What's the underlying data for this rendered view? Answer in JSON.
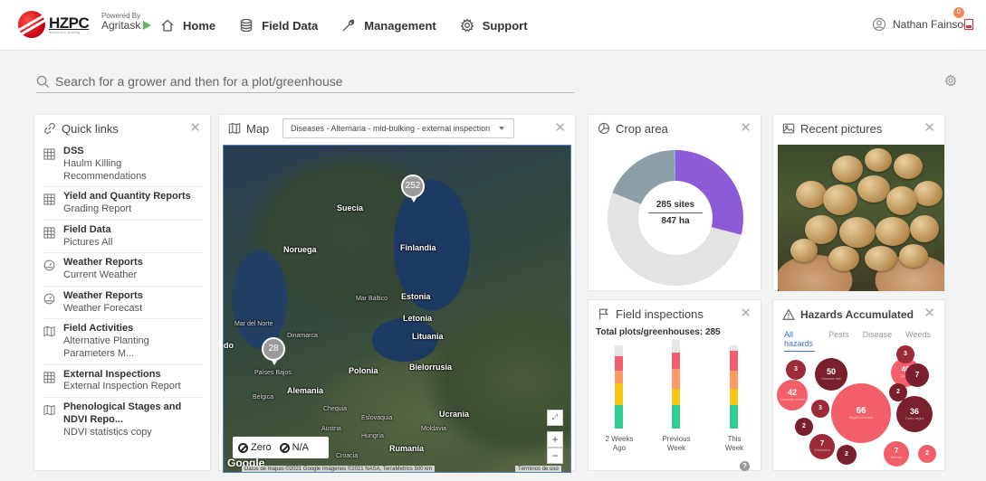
{
  "header": {
    "brand": "HZPC",
    "brand_tagline": "leaves you growing",
    "powered_by": "Powered By",
    "powered_brand": "Agritask",
    "nav": [
      {
        "label": "Home",
        "icon": "home-icon"
      },
      {
        "label": "Field Data",
        "icon": "database-icon"
      },
      {
        "label": "Management",
        "icon": "wrench-icon"
      },
      {
        "label": "Support",
        "icon": "gear-icon"
      }
    ],
    "user_name": "Nathan Fainsod",
    "notification_count": "0"
  },
  "search": {
    "placeholder": "Search for a grower and then for a plot/greenhouse"
  },
  "quick_links": {
    "title": "Quick links",
    "items": [
      {
        "title": "DSS",
        "sub": "Haulm Killing Recommendations",
        "icon": "grid-icon"
      },
      {
        "title": "Yield and Quantity Reports",
        "sub": "Grading Report",
        "icon": "grid-icon"
      },
      {
        "title": "Field Data",
        "sub": "Pictures All",
        "icon": "grid-icon"
      },
      {
        "title": "Weather Reports",
        "sub": "Current Weather",
        "icon": "speedometer-icon"
      },
      {
        "title": "Weather Reports",
        "sub": "Weather Forecast",
        "icon": "speedometer-icon"
      },
      {
        "title": "Field Activities",
        "sub": "Alternative Planting Parameters M...",
        "icon": "map-icon"
      },
      {
        "title": "External Inspections",
        "sub": "External Inspection Report",
        "icon": "grid-icon"
      },
      {
        "title": "Phenological Stages and NDVI Repo...",
        "sub": "NDVI statistics copy",
        "icon": "map-icon"
      }
    ]
  },
  "map": {
    "title": "Map",
    "selected_layer": "Diseases - Alternaria - mid-bulking - external inspection",
    "labels": [
      {
        "text": "Suecia",
        "bold": true
      },
      {
        "text": "Noruega",
        "bold": true
      },
      {
        "text": "Finlandia",
        "bold": true
      },
      {
        "text": "Mar Báltico",
        "bold": false
      },
      {
        "text": "Estonia",
        "bold": true
      },
      {
        "text": "Mar del Norte",
        "bold": false
      },
      {
        "text": "Letonia",
        "bold": true
      },
      {
        "text": "Dinamarca",
        "bold": false
      },
      {
        "text": "Lituania",
        "bold": true
      },
      {
        "text": "do",
        "bold": true
      },
      {
        "text": "Bielorrusia",
        "bold": true
      },
      {
        "text": "Países Bajos",
        "bold": false
      },
      {
        "text": "Polonia",
        "bold": true
      },
      {
        "text": "Alemania",
        "bold": true
      },
      {
        "text": "Bélgica",
        "bold": false
      },
      {
        "text": "Chequia",
        "bold": false
      },
      {
        "text": "Ucrania",
        "bold": true
      },
      {
        "text": "Eslovaquia",
        "bold": false
      },
      {
        "text": "Austria",
        "bold": false
      },
      {
        "text": "Moldavia",
        "bold": false
      },
      {
        "text": "Hungría",
        "bold": false
      },
      {
        "text": "Rumanía",
        "bold": true
      },
      {
        "text": "Croacia",
        "bold": false
      }
    ],
    "clusters": [
      {
        "count": "252"
      },
      {
        "count": "28"
      }
    ],
    "legend": [
      "Zero",
      "N/A"
    ],
    "zoom_in": "+",
    "zoom_out": "−",
    "google": "Google",
    "attribution": "Datos de mapas ©2021 Google Imágenes ©2021 NASA, TerraMetrics  500 km",
    "terms": "Términos de uso"
  },
  "crop_area": {
    "title": "Crop area",
    "sites": "285 sites",
    "hectares": "847 ha",
    "segments": [
      {
        "fraction": 0.29,
        "color": "#8e5bd6"
      },
      {
        "fraction": 0.52,
        "color": "#e3e3e3"
      },
      {
        "fraction": 0.185,
        "color": "#8d9ea7"
      },
      {
        "fraction": 0.005,
        "color": "#6fb8c8"
      }
    ]
  },
  "field_inspections": {
    "title": "Field inspections",
    "total": "Total plots/greenhouses: 285",
    "chart_data": {
      "type": "bar",
      "stacked": true,
      "categories": [
        "2 Weeks Ago",
        "Previous Week",
        "This Week"
      ],
      "series_colors": [
        "#2ecc8f",
        "#f5c518",
        "#ff9a66",
        "#f25f6a",
        "#e6e6e6"
      ]
    },
    "x_labels": [
      [
        "2 Weeks",
        "Ago"
      ],
      [
        "Previous",
        "Week"
      ],
      [
        "This",
        "Week"
      ]
    ],
    "help": "?"
  },
  "recent_pictures": {
    "title": "Recent pictures"
  },
  "hazards": {
    "title": "Hazards Accumulated",
    "tabs": [
      "All hazards",
      "Pests",
      "Disease",
      "Weeds"
    ],
    "bubbles": [
      {
        "value": "66",
        "sub": "Blight Infection"
      },
      {
        "value": "50",
        "sub": "Disease risk"
      },
      {
        "value": "42",
        "sub": "Colorado beetle"
      },
      {
        "value": "40",
        "sub": "Aphid"
      },
      {
        "value": "36",
        "sub": "Early blight"
      },
      {
        "value": "7",
        "sub": "Wireworm"
      },
      {
        "value": "7",
        "sub": "Weeds"
      },
      {
        "value": "7",
        "sub": ""
      },
      {
        "value": "3",
        "sub": ""
      },
      {
        "value": "3",
        "sub": ""
      },
      {
        "value": "3",
        "sub": ""
      },
      {
        "value": "2",
        "sub": ""
      },
      {
        "value": "2",
        "sub": ""
      },
      {
        "value": "2",
        "sub": ""
      },
      {
        "value": "2",
        "sub": ""
      }
    ]
  }
}
